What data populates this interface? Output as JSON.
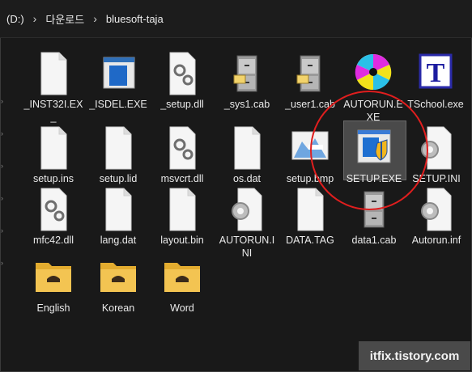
{
  "breadcrumb": {
    "drive": "(D:)",
    "folder1": "다운로드",
    "folder2": "bluesoft-taja"
  },
  "items": [
    {
      "label": "_INST32I.EX_",
      "icon": "blank-file-icon"
    },
    {
      "label": "_ISDEL.EXE",
      "icon": "exe-window-icon"
    },
    {
      "label": "_setup.dll",
      "icon": "settings-file-icon"
    },
    {
      "label": "_sys1.cab",
      "icon": "cabinet-icon"
    },
    {
      "label": "_user1.cab",
      "icon": "cabinet-icon"
    },
    {
      "label": "AUTORUN.EXE",
      "icon": "autorun-colorful-icon"
    },
    {
      "label": "TSchool.exe",
      "icon": "tschool-t-icon"
    },
    {
      "label": "setup.ins",
      "icon": "blank-file-icon"
    },
    {
      "label": "setup.lid",
      "icon": "blank-file-icon"
    },
    {
      "label": "msvcrt.dll",
      "icon": "settings-file-icon"
    },
    {
      "label": "os.dat",
      "icon": "blank-file-icon"
    },
    {
      "label": "setup.bmp",
      "icon": "bitmap-image-icon"
    },
    {
      "label": "SETUP.EXE",
      "icon": "installer-shield-icon",
      "selected": true
    },
    {
      "label": "SETUP.INI",
      "icon": "gear-file-icon"
    },
    {
      "label": "mfc42.dll",
      "icon": "settings-file-icon"
    },
    {
      "label": "lang.dat",
      "icon": "blank-file-icon"
    },
    {
      "label": "layout.bin",
      "icon": "blank-file-icon"
    },
    {
      "label": "AUTORUN.INI",
      "icon": "gear-file-icon"
    },
    {
      "label": "DATA.TAG",
      "icon": "blank-file-icon"
    },
    {
      "label": "data1.cab",
      "icon": "cabinet-icon"
    },
    {
      "label": "Autorun.inf",
      "icon": "gear-file-icon"
    },
    {
      "label": "English",
      "icon": "folder-icon"
    },
    {
      "label": "Korean",
      "icon": "folder-icon"
    },
    {
      "label": "Word",
      "icon": "folder-icon"
    }
  ],
  "watermark": "itfix.tistory.com",
  "colors": {
    "background": "#191919",
    "selection": "#4a4a4a",
    "annotation_circle": "#e01e1e",
    "folder": "#f3c452"
  }
}
